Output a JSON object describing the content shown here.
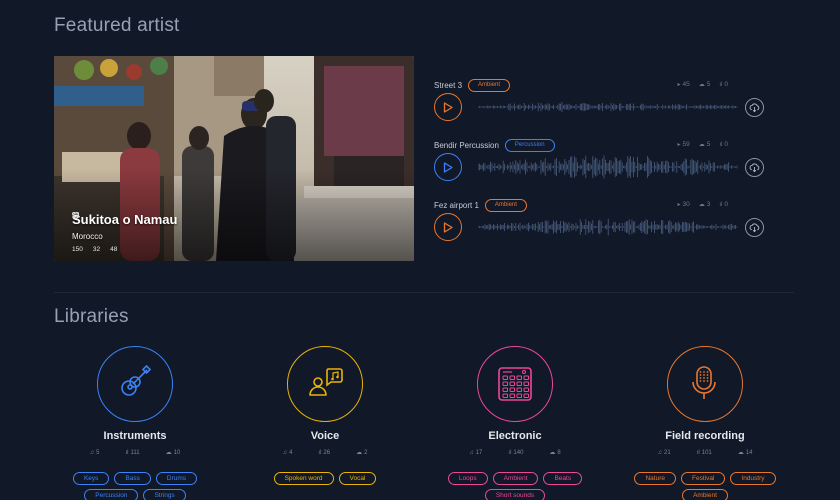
{
  "featured": {
    "title": "Featured artist",
    "artist": {
      "name": "Sukitoa o Namau",
      "location": "Morocco",
      "stats": {
        "views": "150",
        "likes": "32",
        "tracks": "48"
      }
    },
    "tracks": [
      {
        "title": "Street 3",
        "tag": "Ambient",
        "color": "#e8772e",
        "plays": "45",
        "downloads": "5",
        "likes": "0",
        "icon": "play-icon"
      },
      {
        "title": "Bendir Percussion",
        "tag": "Percussion",
        "color": "#3b82f6",
        "plays": "59",
        "downloads": "5",
        "likes": "0",
        "icon": "play-icon"
      },
      {
        "title": "Fez airport 1",
        "tag": "Ambient",
        "color": "#e8772e",
        "plays": "30",
        "downloads": "3",
        "likes": "0",
        "icon": "play-icon"
      }
    ]
  },
  "libraries": {
    "title": "Libraries",
    "items": [
      {
        "name": "Instruments",
        "icon": "guitar-icon",
        "color": "#3b82f6",
        "tracks": "5",
        "sounds": "111",
        "downloads": "10",
        "tags": [
          "Keys",
          "Bass",
          "Drums",
          "Percussion",
          "Strings"
        ]
      },
      {
        "name": "Voice",
        "icon": "voice-icon",
        "color": "#eab308",
        "tracks": "4",
        "sounds": "26",
        "downloads": "2",
        "tags": [
          "Spoken word",
          "Vocal"
        ]
      },
      {
        "name": "Electronic",
        "icon": "drum-pad-icon",
        "color": "#ec4899",
        "tracks": "17",
        "sounds": "140",
        "downloads": "8",
        "tags": [
          "Loops",
          "Ambient",
          "Beats",
          "Short sounds"
        ]
      },
      {
        "name": "Field recording",
        "icon": "microphone-icon",
        "color": "#e8772e",
        "tracks": "21",
        "sounds": "101",
        "downloads": "14",
        "tags": [
          "Nature",
          "Festival",
          "Industry",
          "Ambient"
        ]
      }
    ]
  }
}
